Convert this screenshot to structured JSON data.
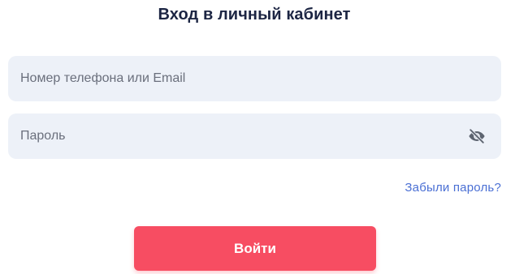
{
  "header": {
    "title": "Вход в личный кабинет"
  },
  "form": {
    "login_placeholder": "Номер телефона или Email",
    "login_value": "",
    "password_placeholder": "Пароль",
    "password_value": "",
    "password_toggle_icon": "eye-off-icon",
    "forgot_password_label": "Забыли пароль?",
    "submit_label": "Войти"
  },
  "colors": {
    "accent": "#f74d62",
    "link": "#4a6fd4",
    "field_background": "#edf1f8",
    "title": "#1c2543"
  }
}
